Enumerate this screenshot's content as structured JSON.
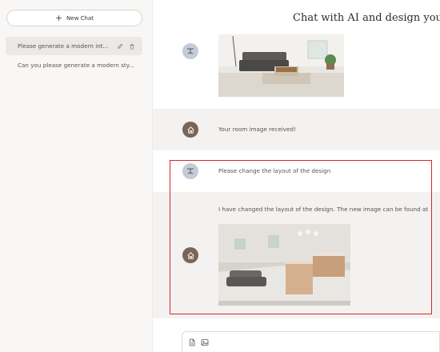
{
  "sidebar": {
    "new_chat_label": "New Chat",
    "chats": [
      {
        "title": "Please generate a modern int...",
        "active": true
      },
      {
        "title": "Can you please generate a modern sty...",
        "active": false
      }
    ]
  },
  "main": {
    "title": "Chat with AI and design your r",
    "messages": [
      {
        "role": "user",
        "type": "image",
        "alt": "living room photo"
      },
      {
        "role": "ai",
        "text": "Your room image received!"
      },
      {
        "role": "user",
        "text": "Please change the layout of the design"
      },
      {
        "role": "ai",
        "text": "I have changed the layout of the design. The new image can be found at",
        "image": "redesigned room render"
      }
    ]
  },
  "colors": {
    "accent_brown": "#7b6558",
    "user_avatar": "#c3cbd8",
    "highlight": "#d9262c"
  },
  "icons": [
    "plus-icon",
    "edit-icon",
    "trash-icon",
    "user-avatar-icon",
    "home-icon",
    "file-icon",
    "image-icon"
  ]
}
